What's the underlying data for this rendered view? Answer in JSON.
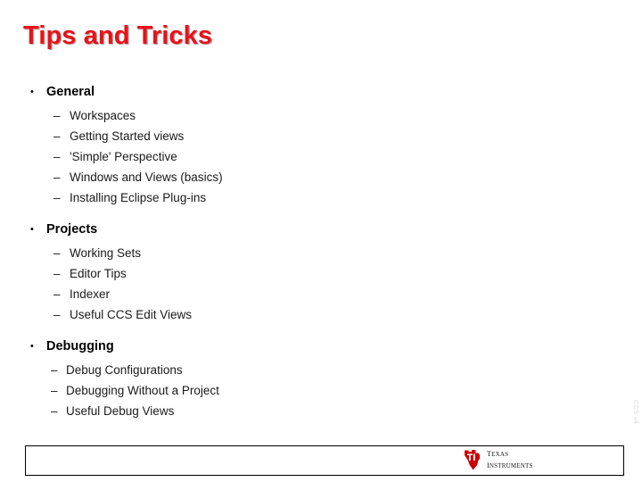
{
  "slide": {
    "title": "Tips and Tricks",
    "groups": [
      {
        "label": "General",
        "bullet": "•",
        "items": [
          "Workspaces",
          "Getting Started views",
          "'Simple' Perspective",
          "Windows and Views (basics)",
          "Installing Eclipse Plug-ins"
        ]
      },
      {
        "label": "Projects",
        "bullet": "•",
        "items": [
          "Working Sets",
          "Editor Tips",
          "Indexer",
          "Useful CCS Edit Views"
        ]
      },
      {
        "label": "Debugging",
        "bullet": "•",
        "items": [
          "Debug Configurations",
          "Debugging Without a Project",
          "Useful Debug Views"
        ]
      }
    ],
    "sub_dash": "–"
  },
  "footer": {
    "logo": {
      "mark_letters": "TI",
      "line1": "Texas",
      "line2": "Instruments"
    },
    "side_watermark": "CCS v4"
  },
  "colors": {
    "title_red": "#e8121a",
    "logo_red": "#cc0000",
    "body_text": "#1a1a1a",
    "border": "#000000",
    "background": "#ffffff"
  }
}
